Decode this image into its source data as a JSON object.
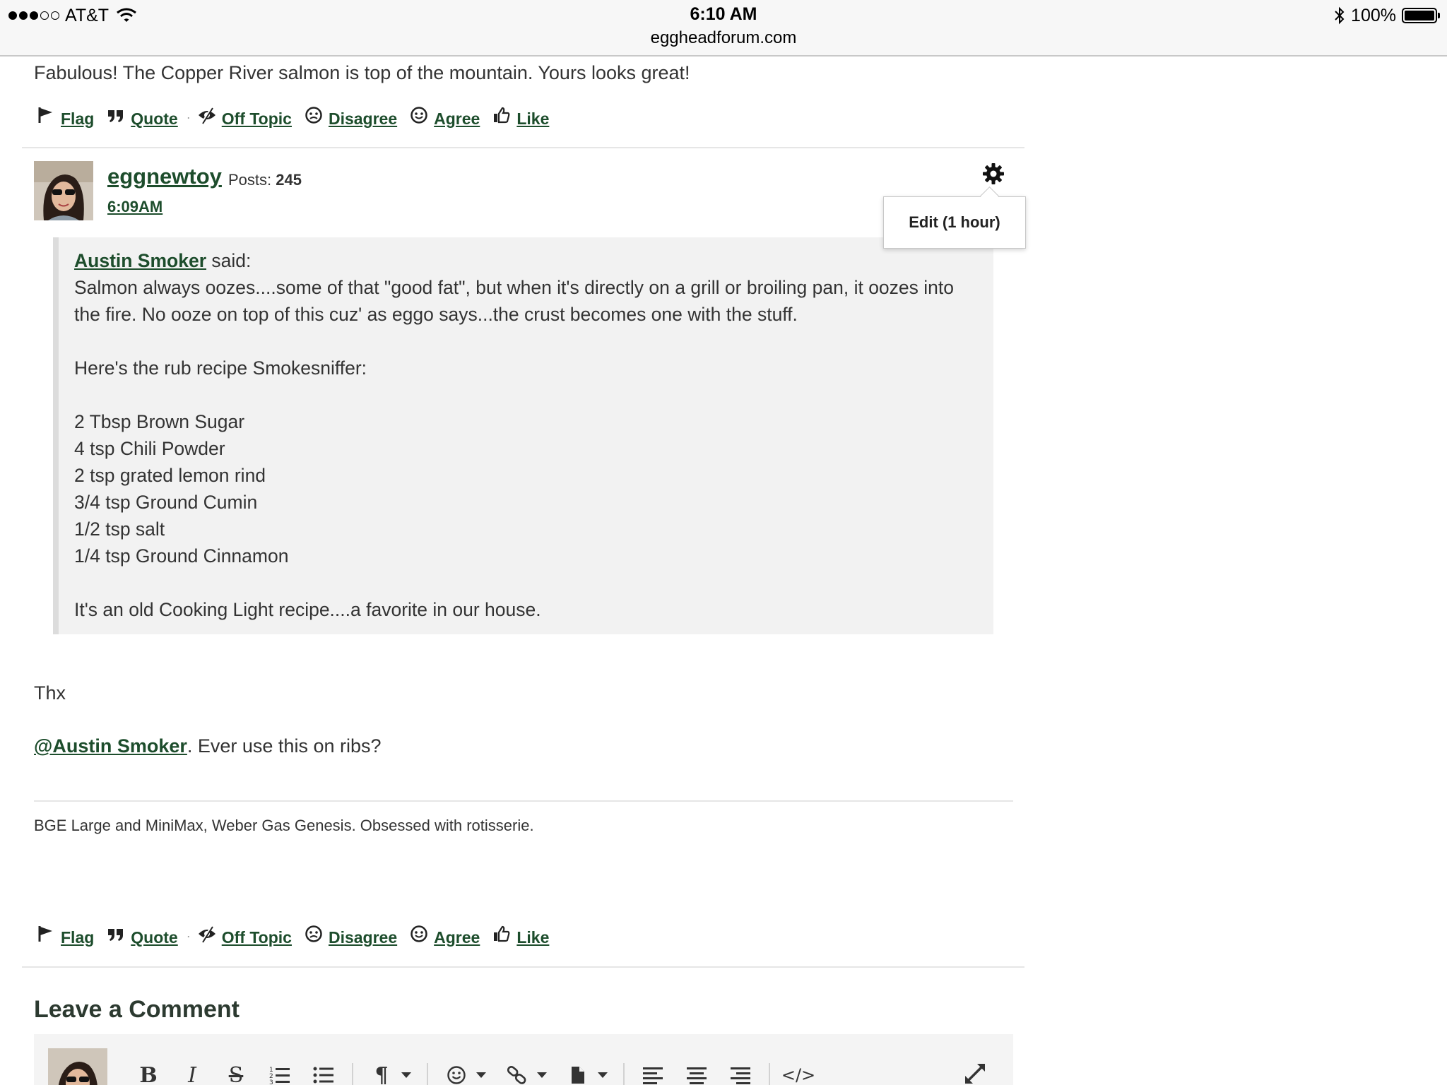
{
  "status_bar": {
    "carrier": "AT&T",
    "time": "6:10 AM",
    "url": "eggheadforum.com",
    "battery": "100%",
    "battery_level": 1.0
  },
  "previous_post": {
    "text": "Fabulous!  The Copper River salmon is top of the mountain.  Yours looks great!"
  },
  "reactions": {
    "flag": "Flag",
    "quote": "Quote",
    "off_topic": "Off Topic",
    "disagree": "Disagree",
    "agree": "Agree",
    "like": "Like"
  },
  "post": {
    "author": "eggnewtoy",
    "posts_label": "Posts:",
    "posts_count": "245",
    "time": "6:09AM",
    "options_menu": {
      "edit": "Edit (1 hour)"
    },
    "quote": {
      "author": "Austin Smoker",
      "said": "said:",
      "line1": "Salmon always oozes....some of that \"good fat\", but when it's directly on a grill or broiling pan, it oozes into the fire. No ooze on top of this cuz' as eggo says...the crust becomes one with the stuff.",
      "line2": "Here's the rub recipe Smokesniffer:",
      "recipe": [
        "2 Tbsp Brown Sugar",
        "4 tsp Chili Powder",
        "2 tsp grated lemon rind",
        "3/4 tsp Ground Cumin",
        "1/2 tsp salt",
        "1/4 tsp Ground Cinnamon"
      ],
      "closing": "It's an old Cooking Light recipe....a favorite in our house."
    },
    "reply_1": "Thx",
    "mention": "@Austin Smoker",
    "reply_2": ". Ever use this on ribs?",
    "signature": "BGE Large and MiniMax, Weber Gas Genesis.  Obsessed with rotisserie."
  },
  "comment": {
    "heading": "Leave a Comment",
    "toolbar": {
      "bold": "B",
      "italic": "I",
      "strike": "S",
      "paragraph": "¶",
      "code": "</>"
    }
  }
}
